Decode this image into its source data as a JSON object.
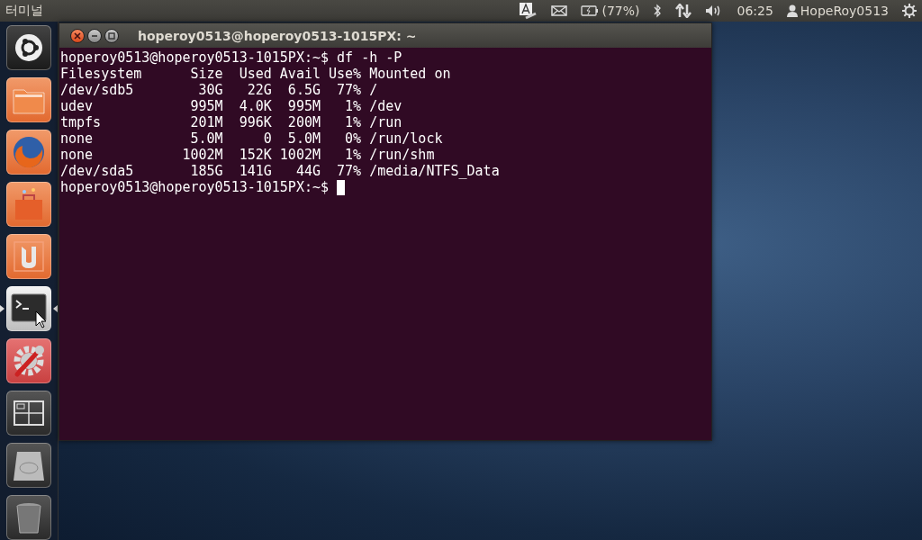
{
  "top_panel": {
    "app_title": "터미널",
    "battery": "(77%)",
    "time": "06:25",
    "user": "HopeRoy0513"
  },
  "launcher": [
    {
      "kind": "dash",
      "running": false,
      "focused": false
    },
    {
      "kind": "files",
      "running": false,
      "focused": false
    },
    {
      "kind": "browser",
      "running": false,
      "focused": false
    },
    {
      "kind": "store",
      "running": false,
      "focused": false
    },
    {
      "kind": "ubuntu-one",
      "running": false,
      "focused": false
    },
    {
      "kind": "terminal",
      "running": true,
      "focused": true
    },
    {
      "kind": "settings",
      "running": false,
      "focused": false
    },
    {
      "kind": "workspaces",
      "running": false,
      "focused": false
    },
    {
      "kind": "drive",
      "running": false,
      "focused": false
    },
    {
      "kind": "trash",
      "running": false,
      "focused": false
    }
  ],
  "terminal": {
    "title": "hoperoy0513@hoperoy0513-1015PX: ~",
    "lines": [
      {
        "kind": "prompt",
        "text": "hoperoy0513@hoperoy0513-1015PX:~$ df -h -P",
        "cursor": false
      },
      {
        "kind": "output",
        "text": "Filesystem      Size  Used Avail Use% Mounted on"
      },
      {
        "kind": "output",
        "text": "/dev/sdb5        30G   22G  6.5G  77% /"
      },
      {
        "kind": "output",
        "text": "udev            995M  4.0K  995M   1% /dev"
      },
      {
        "kind": "output",
        "text": "tmpfs           201M  996K  200M   1% /run"
      },
      {
        "kind": "output",
        "text": "none            5.0M     0  5.0M   0% /run/lock"
      },
      {
        "kind": "output",
        "text": "none           1002M  152K 1002M   1% /run/shm"
      },
      {
        "kind": "output",
        "text": "/dev/sda5       185G  141G   44G  77% /media/NTFS_Data"
      },
      {
        "kind": "prompt",
        "text": "hoperoy0513@hoperoy0513-1015PX:~$",
        "cursor": true
      }
    ]
  }
}
